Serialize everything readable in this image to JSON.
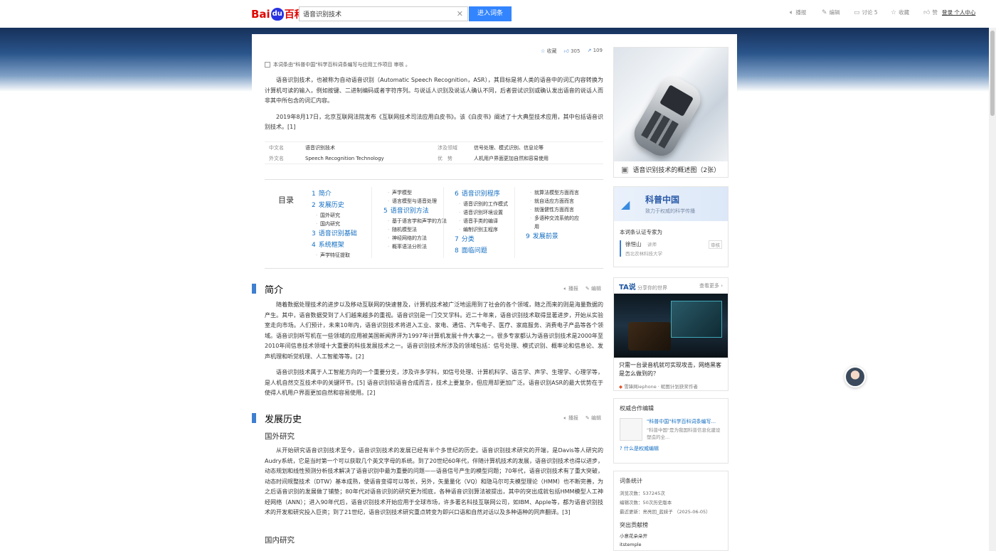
{
  "header": {
    "logo_bai": "Bai",
    "logo_du": "du",
    "logo_baike": "百科",
    "search_value": "语音识别技术",
    "search_button": "进入词条",
    "actions": [
      {
        "icon": "speaker-icon",
        "label": "播报"
      },
      {
        "icon": "pencil-icon",
        "label": "编辑"
      },
      {
        "icon": "comment-icon",
        "label": "讨论 5"
      },
      {
        "icon": "star-icon",
        "label": "收藏"
      },
      {
        "icon": "thumb-icon",
        "label": "赞"
      }
    ],
    "user": "登录  个人中心"
  },
  "article": {
    "top_actions": {
      "collect": "收藏",
      "likes": "305",
      "shares": "109"
    },
    "certification": "本词条由\"科普中国\"科学百科词条编写与应用工作项目 审核 。",
    "intro_p1": "语音识别技术，也被称为自动语音识别（Automatic Speech Recognition，ASR），其目标是将人类的语音中的词汇内容转换为计算机可读的输入，例如按键、二进制编码或者字符序列。与说话人识别及说话人确认不同，后者尝试识别或确认发出语音的说话人而非其中所包含的词汇内容。",
    "intro_p2": "2019年8月17日，北京互联网法院发布《互联网技术司法应用白皮书》。该《白皮书》阐述了十大典型技术应用，其中包括语音识别技术。[1]",
    "basic_info": [
      {
        "k1": "中文名",
        "v1": "语音识别技术",
        "k2": "涉及领域",
        "v2": "信号处理、模式识别、信息论等"
      },
      {
        "k1": "外文名",
        "v1": "Speech Recognition Technology",
        "k2": "优　势",
        "v2": "人机用户界面更加自然和容易使用"
      }
    ],
    "toc": {
      "title": "目录",
      "col1": [
        {
          "num": "1",
          "title": "简介",
          "subs": []
        },
        {
          "num": "2",
          "title": "发展历史",
          "subs": [
            "国外研究",
            "国内研究"
          ]
        },
        {
          "num": "3",
          "title": "语音识别基础",
          "subs": []
        },
        {
          "num": "4",
          "title": "系统框架",
          "subs": [
            "声学特征提取"
          ]
        }
      ],
      "col2_subs_top": [
        "声学模型",
        "语言模型与语音处理"
      ],
      "col2": [
        {
          "num": "5",
          "title": "语音识别方法",
          "subs": [
            "基于语言学和声学的方法",
            "随机模型法",
            "神经网络的方法",
            "概率语法分析法"
          ]
        }
      ],
      "col3": [
        {
          "num": "6",
          "title": "语音识别程序",
          "subs": [
            "语音识别的工作模式",
            "语音识别环境设置",
            "语音手类的编译",
            "编制识别主程序"
          ]
        },
        {
          "num": "7",
          "title": "分类",
          "subs": []
        },
        {
          "num": "8",
          "title": "面临问题",
          "subs": []
        }
      ],
      "col4_subs_top": [
        "就算法模型方面而言",
        "就自适应方面而言",
        "就强健性方面而言",
        "多语种交流系统的应用"
      ],
      "col4": [
        {
          "num": "9",
          "title": "发展前景",
          "subs": []
        }
      ]
    },
    "sec1_title": "简介",
    "sec1_p1": "随着数据处理技术的进步以及移动互联网的快速普及，计算机技术被广泛地运用到了社会的各个领域，随之而来的则是海量数据的产生。其中，语音数据受到了人们越来越多的重视。语音识别是一门交叉学科。近二十年来，语音识别技术取得显著进步，开始从实验室走向市场。人们预计，未来10年内，语音识别技术将进入工业、家电、通信、汽车电子、医疗、家庭服务、消费电子产品等各个领域。语音识别听写机在一些领域的应用被美国新闻界评为1997年计算机发展十件大事之一。很多专家都认为语音识别技术是2000年至2010年间信息技术领域十大重要的科技发展技术之一。语音识别技术所涉及的领域包括：信号处理、模式识别、概率论和信息论、发声机理和听觉机理、人工智能等等。[2]",
    "sec1_p2": "语音识别技术属于人工智能方向的一个重要分支，涉及许多学科，如信号处理、计算机科学、语言学、声学、生理学、心理学等，是人机自然交互技术中的关键环节。[5] 语音识别较语音合成而言，技术上要复杂，但应用却更加广泛。语音识别ASR的最大优势在于使得人机用户界面更加自然和容易使用。[2]",
    "sec2_title": "发展历史",
    "sub1": "国外研究",
    "sec2_p1": "从开始研究语音识别技术至今，语音识别技术的发展已经有半个多世纪的历史。语音识别技术研究的开端，是Davis等人研究的Audry系统，它是当时第一个可以获取几个英文字母的系统。到了20世纪60年代，伴随计算机技术的发展，语音识别技术也得以进步，动态规划和线性预测分析技术解决了语音识别中最为重要的问题——语音信号产生的模型问题；70年代，语音识别技术有了重大突破，动态时间规整技术（DTW）基本成熟，使语音变得可以等长，另外，矢量量化（VQ）和隐马尔可夫模型理论（HMM）也不断完善，为之后语音识别的发展做了铺垫；80年代对语音识别的研究更为彻底，各种语音识别算法被提出，其中的突出成就包括HMM模型人工神经网络（ANN）；进入90年代后，语音识别技术开始应用于全球市场，许多著名科技互联网公司，如IBM、Apple等，都为语音识别技术的开发和研究投入巨资；到了21世纪，语音识别技术研究重点转变为即兴口语和自然对话以及多种语种的同声翻译。[3]",
    "sub2": "国内研究",
    "op_broadcast": "播报",
    "op_edit": "编辑"
  },
  "sidebar": {
    "image_caption": "语音识别技术的概述图（2张）",
    "kp_title": "科普中国",
    "kp_sub": "致力于权威的科学传播",
    "kp_cert_label": "本词条认证专家为",
    "expert_name": "徐恒山",
    "expert_title": "讲师",
    "expert_org": "西北农林科技大学",
    "expert_tag": "审核",
    "ta_logo": "TA说",
    "ta_sub": "分享你的世界",
    "ta_more": "查看更多",
    "ta_title": "只需一台录音机就可实现攻击，网络黑客是怎么做到的？",
    "ta_source": "雪锋网iephone · 昵图计划获奖作者",
    "auth_title": "权威合作编辑",
    "auth_name": "\"科普中国\"科学百科词条编写...",
    "auth_desc": "\"科普中国\"是为我国科普信息化建设塑造的全...",
    "auth_link": "什么是权威编辑",
    "stat_title": "词条统计",
    "stat_views": "浏览次数：537245次",
    "stat_edits": "编辑次数：50次历史版本",
    "stat_updated": "最近更新：亮亮回_蓝妹子 （2025-06-05）",
    "contrib_title": "突出贡献榜",
    "contrib1": "小意花朵朵开",
    "contrib2": "itstemple"
  }
}
